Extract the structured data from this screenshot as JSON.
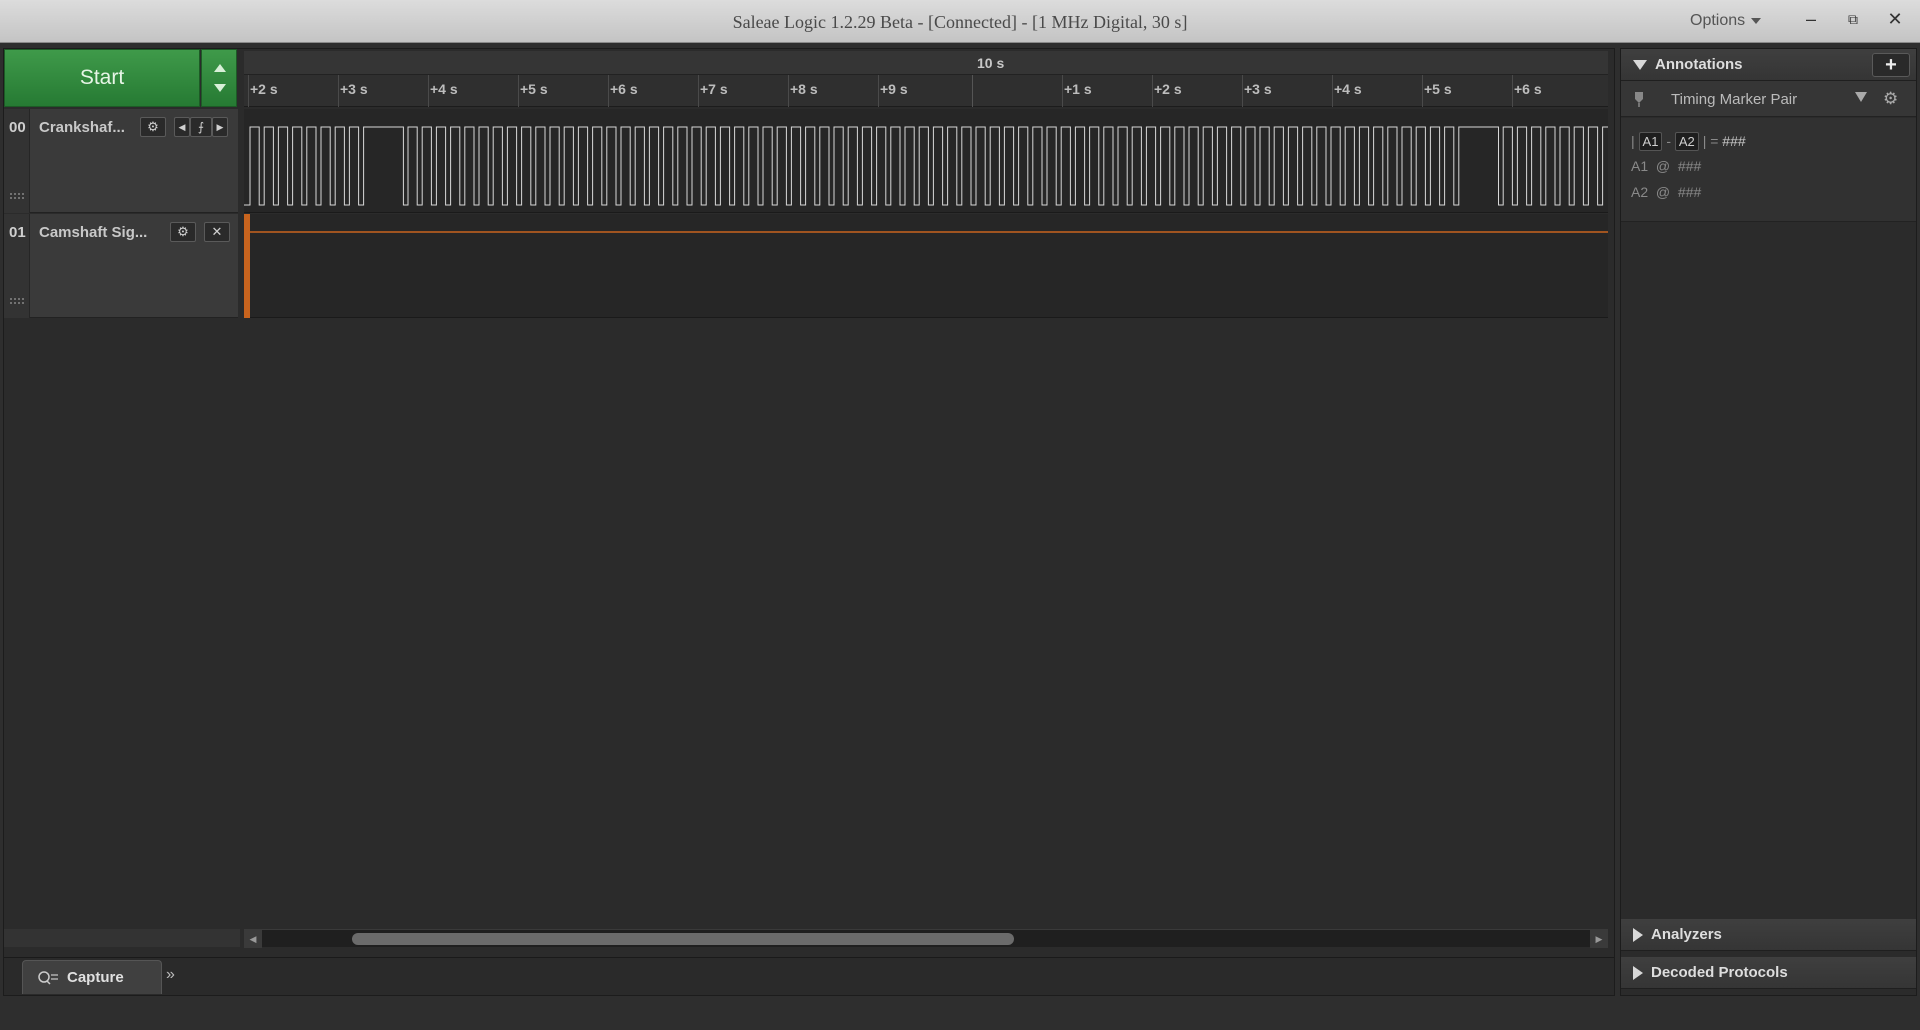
{
  "window": {
    "title": "Saleae Logic 1.2.29 Beta - [Connected] - [1 MHz Digital, 30 s]",
    "options_label": "Options",
    "minimize_glyph": "–",
    "restore_glyph": "⧉",
    "close_glyph": "✕"
  },
  "capture": {
    "start_label": "Start"
  },
  "ruler": {
    "major_label": "10 s",
    "ticks": [
      "+2 s",
      "+3 s",
      "+4 s",
      "+5 s",
      "+6 s",
      "+7 s",
      "+8 s",
      "+9 s",
      "+1 s",
      "+2 s",
      "+3 s",
      "+4 s",
      "+5 s",
      "+6 s"
    ]
  },
  "channels": [
    {
      "number": "00",
      "name": "Crankshaf...",
      "buttons": [
        "gear-icon",
        "prev-edge-icon",
        "trigger-edge-icon",
        "next-edge-icon"
      ]
    },
    {
      "number": "01",
      "name": "Camshaft Sig...",
      "buttons": [
        "gear-icon",
        "close-icon"
      ]
    }
  ],
  "bottom": {
    "capture_tab": "Capture",
    "more_glyph": "»"
  },
  "annotations": {
    "header": "Annotations",
    "add_glyph": "+",
    "marker_title": "Timing Marker Pair",
    "diff_prefix": "|",
    "a1_chip": "A1",
    "dash": "-",
    "a2_chip": "A2",
    "diff_suffix": "| =",
    "diff_value": "###",
    "a1_label": "A1",
    "at": "@",
    "a1_value": "###",
    "a2_label": "A2",
    "a2_value": "###"
  },
  "analyzers": {
    "header": "Analyzers"
  },
  "decoded": {
    "header": "Decoded Protocols"
  },
  "colors": {
    "start_green": "#2f8a3c",
    "camshaft_trace": "#c8641e",
    "waveform": "#d8d8d8"
  }
}
